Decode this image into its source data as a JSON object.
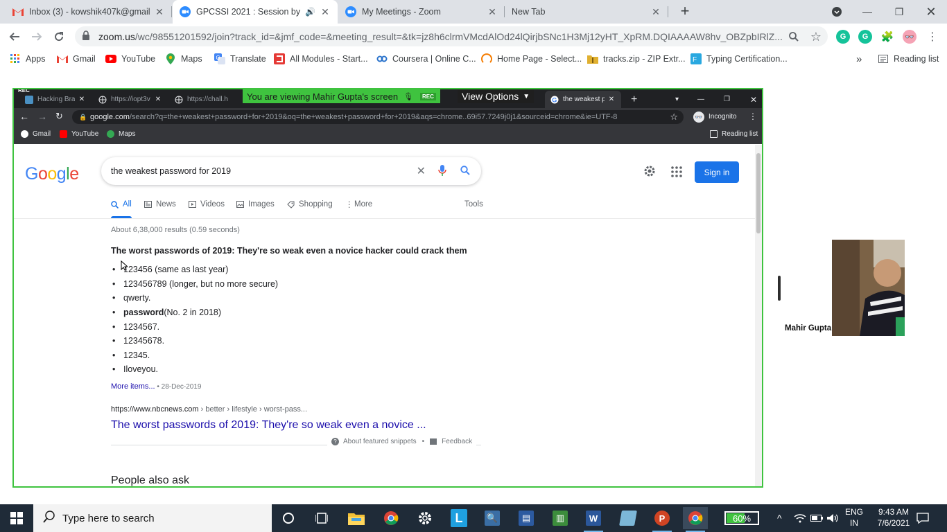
{
  "outer_tabs": [
    {
      "title": "Inbox (3) - kowshik407k@gmail.com",
      "icon": "gmail-icon"
    },
    {
      "title": "GPCSSI 2021 : Session by Mr.",
      "icon": "zoom-icon"
    },
    {
      "title": "My Meetings - Zoom",
      "icon": "zoom-icon"
    },
    {
      "title": "New Tab",
      "icon": ""
    }
  ],
  "outer_url": {
    "host": "zoom.us",
    "rest": "/wc/98551201592/join?track_id=&jmf_code=&meeting_result=&tk=jz8h6clrmVMcdAlOd24lQirjbSNc1H3Mj12yHT_XpRM.DQIAAAAW8hv_OBZpbIRlZ..."
  },
  "outer_bookmarks": [
    {
      "label": "Apps"
    },
    {
      "label": "Gmail"
    },
    {
      "label": "YouTube"
    },
    {
      "label": "Maps"
    },
    {
      "label": "Translate"
    },
    {
      "label": "All Modules - Start..."
    },
    {
      "label": "Coursera | Online C..."
    },
    {
      "label": "Home Page - Select..."
    },
    {
      "label": "tracks.zip - ZIP Extr..."
    },
    {
      "label": "Typing Certification..."
    }
  ],
  "outer_reading_list": "Reading list",
  "outer_more": "»",
  "share": {
    "rec": "REC",
    "banner": "You are viewing Mahir Gupta's screen",
    "banner_rec": "REC",
    "view_options": "View Options",
    "tabs": [
      {
        "title": "Hacking Brav..."
      },
      {
        "title": "https://iopt3v"
      },
      {
        "title": "https://chall.h"
      },
      {
        "title": "the weakest p"
      }
    ],
    "url_host": "google.com",
    "url_rest": "/search?q=the+weakest+password+for+2019&oq=the+weakest+password+for+2019&aqs=chrome..69i57.7249j0j1&sourceid=chrome&ie=UTF-8",
    "incognito": "Incognito",
    "bookmarks": [
      {
        "label": "Gmail"
      },
      {
        "label": "YouTube"
      },
      {
        "label": "Maps"
      }
    ],
    "reading_list": "Reading list"
  },
  "google": {
    "logo": "Google",
    "query": "the weakest password for 2019",
    "sign_in": "Sign in",
    "tabs": [
      "All",
      "News",
      "Videos",
      "Images",
      "Shopping",
      "More",
      "Tools"
    ],
    "stats": "About 6,38,000 results (0.59 seconds)",
    "featured_title": "The worst passwords of 2019: They're so weak even a novice hacker could crack them",
    "list": [
      {
        "strong": "",
        "text": "123456 (same as last year)"
      },
      {
        "strong": "",
        "text": "123456789 (longer, but no more secure)"
      },
      {
        "strong": "",
        "text": "qwerty."
      },
      {
        "strong": "password",
        "text": " (No. 2 in 2018)"
      },
      {
        "strong": "",
        "text": "1234567."
      },
      {
        "strong": "",
        "text": "12345678."
      },
      {
        "strong": "",
        "text": "12345."
      },
      {
        "strong": "",
        "text": "Iloveyou."
      }
    ],
    "more_items": "More items...",
    "more_date": " • 28-Dec-2019",
    "cite_host": "https://www.nbcnews.com",
    "cite_path": " › better › lifestyle › worst-pass...",
    "result_title": "The worst passwords of 2019: They're so weak even a novice ...",
    "about_snippets": "About featured snippets",
    "feedback": "Feedback",
    "people_also_ask": "People also ask"
  },
  "zoom": {
    "participant_name": "Mahir Gupta"
  },
  "taskbar": {
    "search_placeholder": "Type here to search",
    "battery": "60%",
    "battery_level": 0.6,
    "lang_top": "ENG",
    "lang_bottom": "IN",
    "time": "9:43 AM",
    "date": "7/6/2021"
  }
}
